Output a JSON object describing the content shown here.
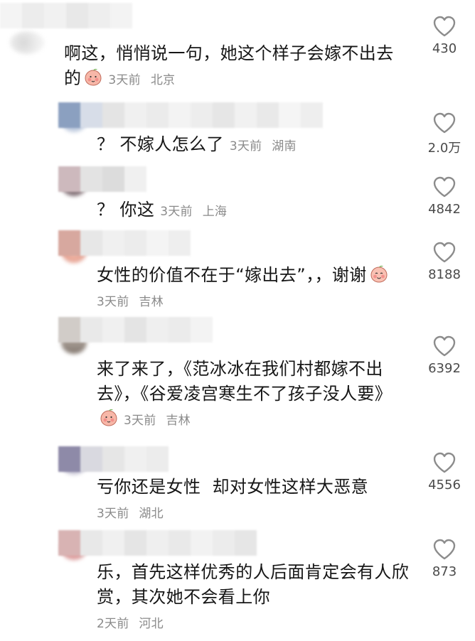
{
  "comments": [
    {
      "text": "啊这，悄悄说一句，她这个样子会嫁不出去的",
      "has_emoji": true,
      "emoji_icon": "blushing-peach-emoji-icon",
      "time": "3天前",
      "location": "北京",
      "likes": "430",
      "is_reply": false
    },
    {
      "text": "？ 不嫁人怎么了",
      "has_emoji": false,
      "time": "3天前",
      "location": "湖南",
      "likes": "2.0万",
      "is_reply": true
    },
    {
      "text": "？ 你这",
      "has_emoji": false,
      "time": "3天前",
      "location": "上海",
      "likes": "4842",
      "is_reply": true
    },
    {
      "text": "女性的价值不在于“嫁出去”，，谢谢",
      "has_emoji": true,
      "emoji_icon": "smiling-peach-emoji-icon",
      "time": "3天前",
      "location": "吉林",
      "likes": "8188",
      "is_reply": true
    },
    {
      "text": "来了来了，《范冰冰在我们村都嫁不出去》，《谷爱凌宫寒生不了孩子没人要》",
      "has_emoji": true,
      "emoji_icon": "blushing-peach-emoji-icon",
      "time": "3天前",
      "location": "吉林",
      "likes": "6392",
      "is_reply": true
    },
    {
      "text": "亏你还是女性  却对女性这样大恶意",
      "has_emoji": false,
      "time": "3天前",
      "location": "湖北",
      "likes": "4556",
      "is_reply": true
    },
    {
      "text": "乐，首先这样优秀的人后面肯定会有人欣赏，其次她不会看上你",
      "has_emoji": false,
      "time": "2天前",
      "location": "河北",
      "likes": "873",
      "is_reply": true
    }
  ],
  "colors": {
    "text": "#161616",
    "meta": "#8a8a8a",
    "like_count": "#4a4a4a",
    "heart_outline": "#8c8c8c"
  }
}
